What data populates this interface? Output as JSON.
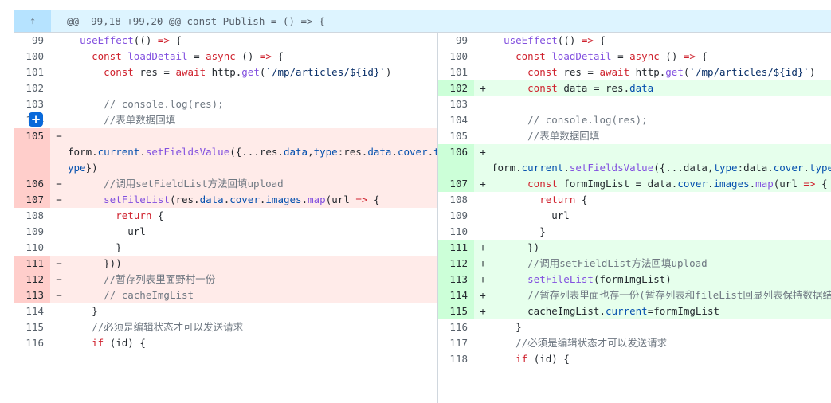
{
  "hunk": {
    "expand_icon": "expand-up-icon",
    "expand_glyph": "⤒",
    "header": "@@ -99,18 +99,20 @@ const Publish = () => {"
  },
  "left": {
    "rows": [
      {
        "type": "ctx",
        "num": "99",
        "sign": "",
        "tokens": [
          {
            "t": "  "
          },
          {
            "t": "useEffect",
            "c": "fn"
          },
          {
            "t": "(() "
          },
          {
            "t": "=>",
            "c": "kw"
          },
          {
            "t": " {"
          }
        ]
      },
      {
        "type": "ctx",
        "num": "100",
        "sign": "",
        "tokens": [
          {
            "t": "    "
          },
          {
            "t": "const",
            "c": "kw"
          },
          {
            "t": " "
          },
          {
            "t": "loadDetail",
            "c": "fn"
          },
          {
            "t": " = "
          },
          {
            "t": "async",
            "c": "kw"
          },
          {
            "t": " () "
          },
          {
            "t": "=>",
            "c": "kw"
          },
          {
            "t": " {"
          }
        ]
      },
      {
        "type": "ctx",
        "num": "101",
        "sign": "",
        "tokens": [
          {
            "t": "      "
          },
          {
            "t": "const",
            "c": "kw"
          },
          {
            "t": " res = "
          },
          {
            "t": "await",
            "c": "kw"
          },
          {
            "t": " http."
          },
          {
            "t": "get",
            "c": "fn"
          },
          {
            "t": "("
          },
          {
            "t": "`/mp/articles/${id}`",
            "c": "str"
          },
          {
            "t": ")"
          }
        ]
      },
      {
        "type": "empty",
        "num": "",
        "sign": "",
        "tokens": []
      },
      {
        "type": "ctx",
        "num": "102",
        "sign": "",
        "tokens": []
      },
      {
        "type": "ctx",
        "num": "103",
        "sign": "",
        "tokens": [
          {
            "t": "      "
          },
          {
            "t": "// console.log(res);",
            "c": "cm"
          }
        ]
      },
      {
        "type": "ctx",
        "num": "104",
        "sign": "",
        "tokens": [
          {
            "t": "      "
          },
          {
            "t": "//表单数据回填",
            "c": "cm"
          }
        ]
      },
      {
        "type": "del",
        "num": "105",
        "sign": "−",
        "tokens": []
      },
      {
        "type": "del",
        "num": "",
        "sign": "",
        "tokens": [
          {
            "t": "form."
          },
          {
            "t": "current",
            "c": "prop"
          },
          {
            "t": "."
          },
          {
            "t": "setFieldsValue",
            "c": "fn"
          },
          {
            "t": "({...res."
          },
          {
            "t": "data",
            "c": "prop"
          },
          {
            "t": ","
          },
          {
            "t": "type",
            "c": "prop"
          },
          {
            "t": ":res."
          },
          {
            "t": "data",
            "c": "prop"
          },
          {
            "t": "."
          },
          {
            "t": "cover",
            "c": "prop"
          },
          {
            "t": "."
          },
          {
            "t": "t",
            "c": "prop"
          }
        ]
      },
      {
        "type": "del",
        "num": "",
        "sign": "",
        "tokens": [
          {
            "t": "ype",
            "c": "prop"
          },
          {
            "t": "})"
          }
        ]
      },
      {
        "type": "del",
        "num": "106",
        "sign": "−",
        "tokens": [
          {
            "t": "      "
          },
          {
            "t": "//调用setFieldList方法回填upload",
            "c": "cm"
          }
        ]
      },
      {
        "type": "del",
        "num": "107",
        "sign": "−",
        "tokens": [
          {
            "t": "      "
          },
          {
            "t": "setFileList",
            "c": "fn"
          },
          {
            "t": "(res."
          },
          {
            "t": "data",
            "c": "prop"
          },
          {
            "t": "."
          },
          {
            "t": "cover",
            "c": "prop"
          },
          {
            "t": "."
          },
          {
            "t": "images",
            "c": "prop"
          },
          {
            "t": "."
          },
          {
            "t": "map",
            "c": "fn"
          },
          {
            "t": "(url "
          },
          {
            "t": "=>",
            "c": "kw"
          },
          {
            "t": " {"
          }
        ]
      },
      {
        "type": "ctx",
        "num": "108",
        "sign": "",
        "tokens": [
          {
            "t": "        "
          },
          {
            "t": "return",
            "c": "kw"
          },
          {
            "t": " {"
          }
        ]
      },
      {
        "type": "ctx",
        "num": "109",
        "sign": "",
        "tokens": [
          {
            "t": "          url"
          }
        ]
      },
      {
        "type": "ctx",
        "num": "110",
        "sign": "",
        "tokens": [
          {
            "t": "        }"
          }
        ]
      },
      {
        "type": "del",
        "num": "111",
        "sign": "−",
        "tokens": [
          {
            "t": "      }))"
          }
        ]
      },
      {
        "type": "del",
        "num": "112",
        "sign": "−",
        "tokens": [
          {
            "t": "      "
          },
          {
            "t": "//暂存列表里面野村一份",
            "c": "cm"
          }
        ]
      },
      {
        "type": "del",
        "num": "113",
        "sign": "−",
        "tokens": [
          {
            "t": "      "
          },
          {
            "t": "// cacheImgList",
            "c": "cm"
          }
        ]
      },
      {
        "type": "empty",
        "num": "",
        "sign": "",
        "tokens": []
      },
      {
        "type": "empty",
        "num": "",
        "sign": "",
        "tokens": []
      },
      {
        "type": "ctx",
        "num": "114",
        "sign": "",
        "tokens": [
          {
            "t": "    }"
          }
        ]
      },
      {
        "type": "ctx",
        "num": "115",
        "sign": "",
        "tokens": [
          {
            "t": "    "
          },
          {
            "t": "//必须是编辑状态才可以发送请求",
            "c": "cm"
          }
        ]
      },
      {
        "type": "ctx",
        "num": "116",
        "sign": "",
        "tokens": [
          {
            "t": "    "
          },
          {
            "t": "if",
            "c": "kw"
          },
          {
            "t": " (id) {"
          }
        ]
      }
    ]
  },
  "right": {
    "rows": [
      {
        "type": "ctx",
        "num": "99",
        "sign": "",
        "tokens": [
          {
            "t": "  "
          },
          {
            "t": "useEffect",
            "c": "fn"
          },
          {
            "t": "(() "
          },
          {
            "t": "=>",
            "c": "kw"
          },
          {
            "t": " {"
          }
        ]
      },
      {
        "type": "ctx",
        "num": "100",
        "sign": "",
        "tokens": [
          {
            "t": "    "
          },
          {
            "t": "const",
            "c": "kw"
          },
          {
            "t": " "
          },
          {
            "t": "loadDetail",
            "c": "fn"
          },
          {
            "t": " = "
          },
          {
            "t": "async",
            "c": "kw"
          },
          {
            "t": " () "
          },
          {
            "t": "=>",
            "c": "kw"
          },
          {
            "t": " {"
          }
        ]
      },
      {
        "type": "ctx",
        "num": "101",
        "sign": "",
        "tokens": [
          {
            "t": "      "
          },
          {
            "t": "const",
            "c": "kw"
          },
          {
            "t": " res = "
          },
          {
            "t": "await",
            "c": "kw"
          },
          {
            "t": " http."
          },
          {
            "t": "get",
            "c": "fn"
          },
          {
            "t": "("
          },
          {
            "t": "`/mp/articles/${id}`",
            "c": "str"
          },
          {
            "t": ")"
          }
        ]
      },
      {
        "type": "add",
        "num": "102",
        "sign": "+",
        "tokens": [
          {
            "t": "      "
          },
          {
            "t": "const",
            "c": "kw"
          },
          {
            "t": " data = res."
          },
          {
            "t": "data",
            "c": "prop"
          }
        ]
      },
      {
        "type": "ctx",
        "num": "103",
        "sign": "",
        "tokens": []
      },
      {
        "type": "ctx",
        "num": "104",
        "sign": "",
        "tokens": [
          {
            "t": "      "
          },
          {
            "t": "// console.log(res);",
            "c": "cm"
          }
        ]
      },
      {
        "type": "ctx",
        "num": "105",
        "sign": "",
        "tokens": [
          {
            "t": "      "
          },
          {
            "t": "//表单数据回填",
            "c": "cm"
          }
        ]
      },
      {
        "type": "add",
        "num": "106",
        "sign": "+",
        "tokens": []
      },
      {
        "type": "add",
        "num": "",
        "sign": "",
        "tokens": [
          {
            "t": "form."
          },
          {
            "t": "current",
            "c": "prop"
          },
          {
            "t": "."
          },
          {
            "t": "setFieldsValue",
            "c": "fn"
          },
          {
            "t": "({...data,"
          },
          {
            "t": "type",
            "c": "prop"
          },
          {
            "t": ":data."
          },
          {
            "t": "cover",
            "c": "prop"
          },
          {
            "t": "."
          },
          {
            "t": "type",
            "c": "prop"
          },
          {
            "t": "})"
          }
        ]
      },
      {
        "type": "add",
        "num": "",
        "sign": "",
        "tokens": []
      },
      {
        "type": "add",
        "num": "107",
        "sign": "+",
        "tokens": [
          {
            "t": "      "
          },
          {
            "t": "const",
            "c": "kw"
          },
          {
            "t": " formImgList = data."
          },
          {
            "t": "cover",
            "c": "prop"
          },
          {
            "t": "."
          },
          {
            "t": "images",
            "c": "prop"
          },
          {
            "t": "."
          },
          {
            "t": "map",
            "c": "fn"
          },
          {
            "t": "(url "
          },
          {
            "t": "=>",
            "c": "kw"
          },
          {
            "t": " {"
          }
        ]
      },
      {
        "type": "empty",
        "num": "",
        "sign": "",
        "tokens": []
      },
      {
        "type": "ctx",
        "num": "108",
        "sign": "",
        "tokens": [
          {
            "t": "        "
          },
          {
            "t": "return",
            "c": "kw"
          },
          {
            "t": " {"
          }
        ]
      },
      {
        "type": "ctx",
        "num": "109",
        "sign": "",
        "tokens": [
          {
            "t": "          url"
          }
        ]
      },
      {
        "type": "ctx",
        "num": "110",
        "sign": "",
        "tokens": [
          {
            "t": "        }"
          }
        ]
      },
      {
        "type": "add",
        "num": "111",
        "sign": "+",
        "tokens": [
          {
            "t": "      })"
          }
        ]
      },
      {
        "type": "add",
        "num": "112",
        "sign": "+",
        "tokens": [
          {
            "t": "      "
          },
          {
            "t": "//调用setFieldList方法回填upload",
            "c": "cm"
          }
        ]
      },
      {
        "type": "add",
        "num": "113",
        "sign": "+",
        "tokens": [
          {
            "t": "      "
          },
          {
            "t": "setFileList",
            "c": "fn"
          },
          {
            "t": "(formImgList)"
          }
        ]
      },
      {
        "type": "add",
        "num": "114",
        "sign": "+",
        "tokens": [
          {
            "t": "      "
          },
          {
            "t": "//暂存列表里面也存一份(暂存列表和fileList回显列表保持数据结构统",
            "c": "cm"
          }
        ]
      },
      {
        "type": "add",
        "num": "115",
        "sign": "+",
        "tokens": [
          {
            "t": "      cacheImgList."
          },
          {
            "t": "current",
            "c": "prop"
          },
          {
            "t": "=formImgList"
          }
        ]
      },
      {
        "type": "ctx",
        "num": "116",
        "sign": "",
        "tokens": [
          {
            "t": "    }"
          }
        ]
      },
      {
        "type": "ctx",
        "num": "117",
        "sign": "",
        "tokens": [
          {
            "t": "    "
          },
          {
            "t": "//必须是编辑状态才可以发送请求",
            "c": "cm"
          }
        ]
      },
      {
        "type": "ctx",
        "num": "118",
        "sign": "",
        "tokens": [
          {
            "t": "    "
          },
          {
            "t": "if",
            "c": "kw"
          },
          {
            "t": " (id) {"
          }
        ]
      }
    ]
  },
  "add_comment": {
    "label": "+",
    "icon": "plus-icon"
  }
}
